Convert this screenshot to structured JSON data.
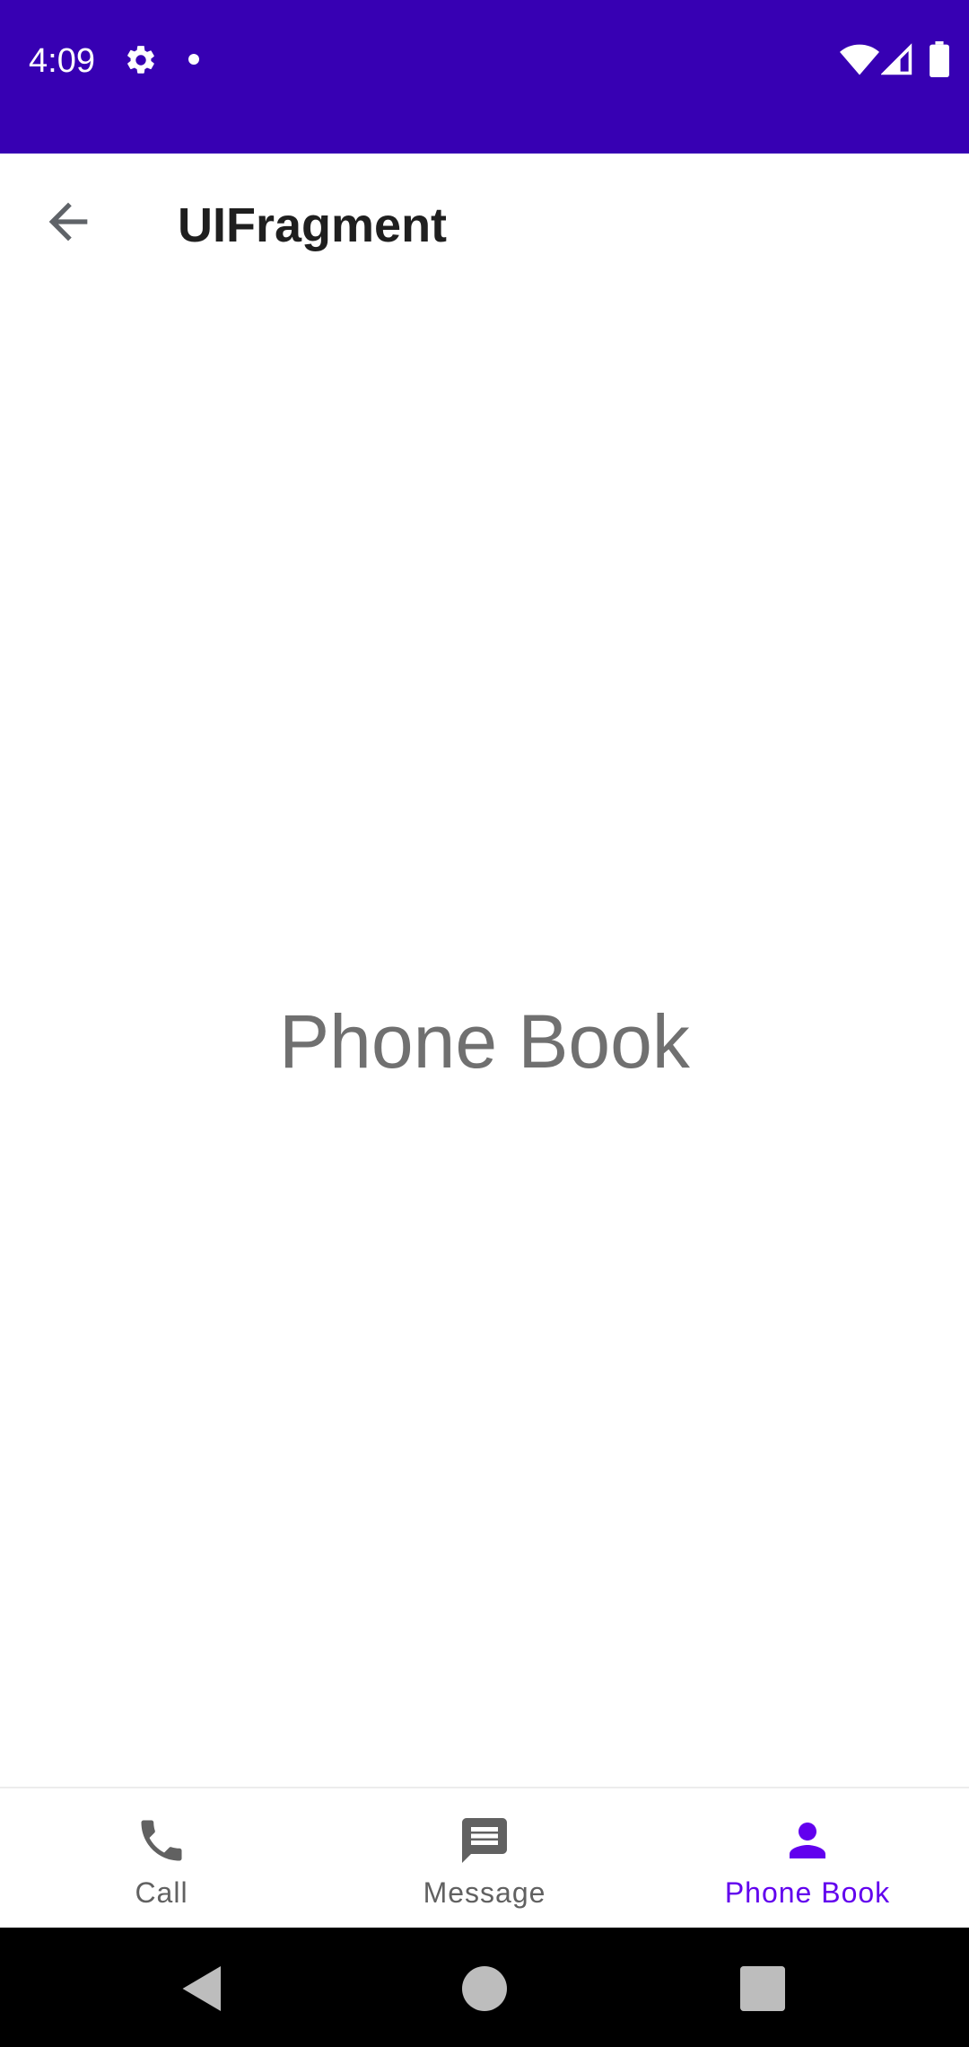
{
  "status_bar": {
    "time": "4:09",
    "icons": [
      "gear-icon",
      "notification-dot-icon",
      "wifi-icon",
      "signal-icon",
      "battery-icon"
    ],
    "background": "#3700b3"
  },
  "toolbar": {
    "back_icon": "arrow-back-icon",
    "title": "UIFragment"
  },
  "content": {
    "text": "Phone Book"
  },
  "bottom_nav": {
    "items": [
      {
        "label": "Call",
        "icon": "phone-icon",
        "active": false
      },
      {
        "label": "Message",
        "icon": "message-icon",
        "active": false
      },
      {
        "label": "Phone Book",
        "icon": "person-icon",
        "active": true
      }
    ],
    "active_color": "#6200ee",
    "inactive_color": "#616161"
  },
  "system_nav": {
    "buttons": [
      "back-triangle-icon",
      "home-circle-icon",
      "recents-square-icon"
    ]
  }
}
